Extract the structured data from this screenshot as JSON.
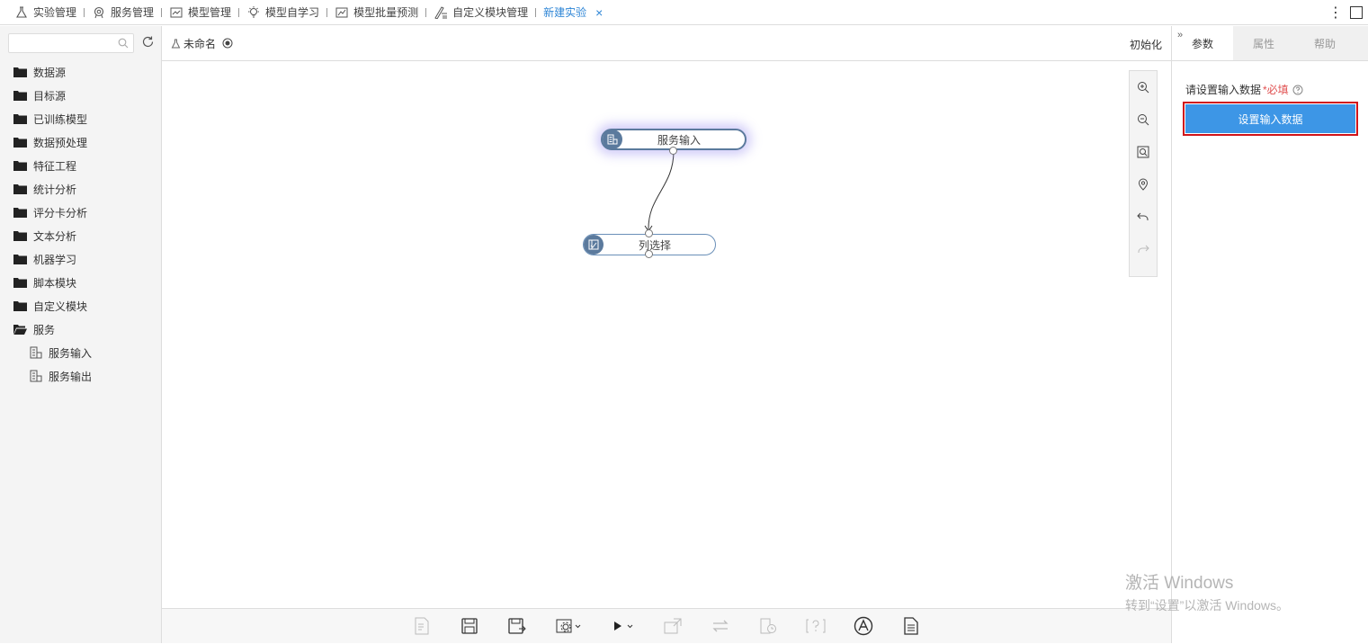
{
  "nav": {
    "tabs": [
      {
        "label": "实验管理",
        "icon": "flask-icon"
      },
      {
        "label": "服务管理",
        "icon": "service-icon"
      },
      {
        "label": "模型管理",
        "icon": "model-chart-icon"
      },
      {
        "label": "模型自学习",
        "icon": "lightbulb-icon"
      },
      {
        "label": "模型批量预测",
        "icon": "trend-chart-icon"
      },
      {
        "label": "自定义模块管理",
        "icon": "custom-edit-icon"
      }
    ],
    "active_tab": "新建实验",
    "close_glyph": "×",
    "more_glyph": "⋮"
  },
  "sidebar": {
    "search_placeholder": "",
    "folders": [
      "数据源",
      "目标源",
      "已训练模型",
      "数据预处理",
      "特征工程",
      "统计分析",
      "评分卡分析",
      "文本分析",
      "机器学习",
      "脚本模块",
      "自定义模块",
      "服务"
    ],
    "service_children": [
      "服务输入",
      "服务输出"
    ]
  },
  "experiment": {
    "name": "未命名",
    "init_label": "初始化"
  },
  "canvas": {
    "nodes": [
      {
        "label": "服务输入",
        "icon": "database-icon"
      },
      {
        "label": "列选择",
        "icon": "column-select-icon"
      }
    ]
  },
  "right_panel": {
    "tabs": [
      "参数",
      "属性",
      "帮助"
    ],
    "active_tab": "参数",
    "param_label": "请设置输入数据",
    "required_text": "*必填",
    "set_button_label": "设置输入数据"
  },
  "watermark": {
    "line1": "激活 Windows",
    "line2": "转到“设置”以激活 Windows。"
  },
  "colors": {
    "accent": "#3d96e6",
    "active_tab_text": "#2f86d6",
    "highlight_border": "#d0141a",
    "node_icon_bg": "#5b7a9d"
  }
}
